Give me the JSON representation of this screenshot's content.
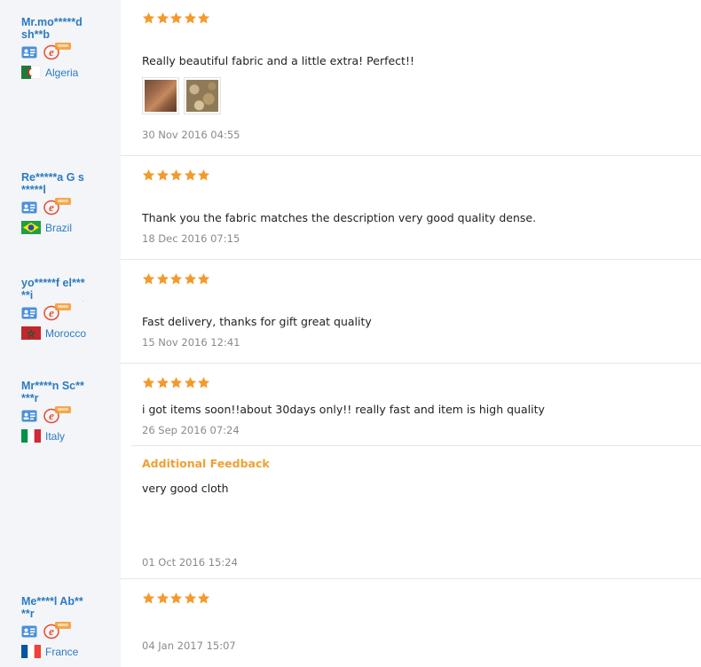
{
  "colors": {
    "star": "#f39a2b",
    "link_blue": "#2b7bc0",
    "feedback_title": "#f0a032",
    "date_grey": "#8a8a8a"
  },
  "reviews": [
    {
      "user_name": "Mr.mo*****d sh**b",
      "country": "Algeria",
      "flag_icon": "algeria-flag-icon",
      "rating": 5,
      "text": "Really beautiful fabric and a little extra! Perfect!!",
      "date": "30 Nov 2016 04:55",
      "photos": [
        "fabric-photo-1",
        "fabric-photo-2"
      ]
    },
    {
      "user_name": "Re*****a G s*****l",
      "country": "Brazil",
      "flag_icon": "brazil-flag-icon",
      "rating": 5,
      "text": "Thank you the fabric matches the description very good quality dense.",
      "date": "18 Dec 2016 07:15"
    },
    {
      "user_name": "yo*****f el*****i",
      "country": "Morocco",
      "flag_icon": "morocco-flag-icon",
      "rating": 5,
      "text": "Fast delivery, thanks for gift great quality",
      "date": "15 Nov 2016 12:41"
    },
    {
      "user_name": "Mr****n Sc*****r",
      "country": "Italy",
      "flag_icon": "italy-flag-icon",
      "rating": 5,
      "text": "i got items soon!!about 30days only!! really fast and item is high quality",
      "date": "26 Sep 2016 07:24",
      "additional_feedback": {
        "title": "Additional Feedback",
        "text": "very good cloth",
        "date": "01 Oct 2016 15:24"
      }
    },
    {
      "user_name": "Me****l Ab****r",
      "country": "France",
      "flag_icon": "france-flag-icon",
      "rating": 5,
      "text": "",
      "date": "04 Jan 2017 15:07"
    }
  ]
}
